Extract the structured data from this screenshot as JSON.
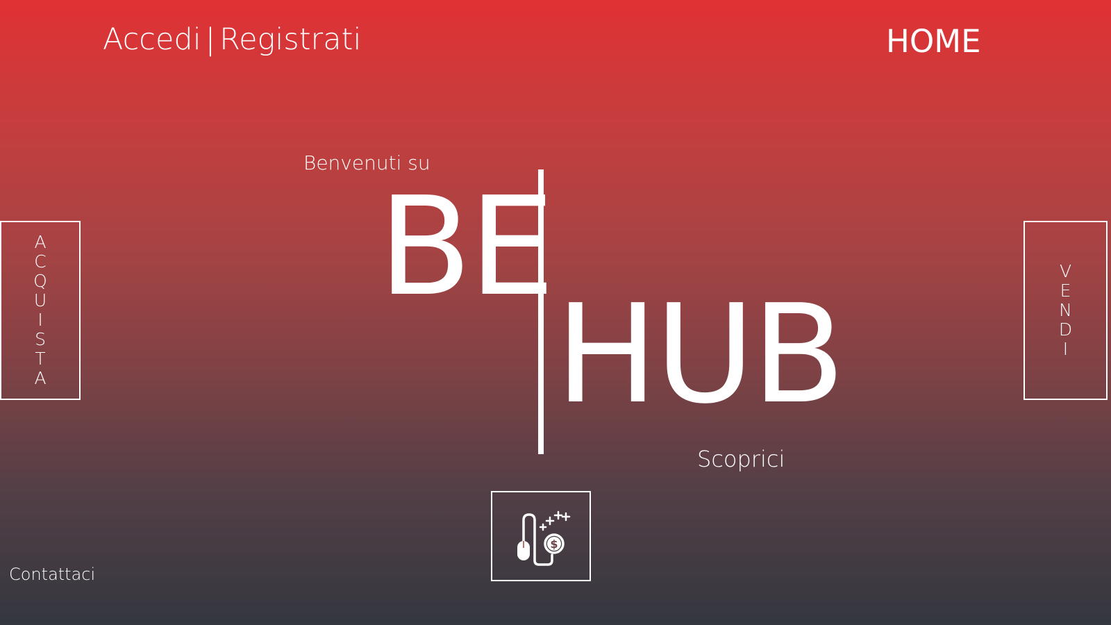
{
  "header": {
    "login_label": "Accedi",
    "separator": "|",
    "register_label": "Registrati",
    "home_label": "HOME"
  },
  "hero": {
    "welcome_text": "Benvenuti su",
    "logo_left": "BE",
    "logo_right": "HUB",
    "discover_label": "Scoprici"
  },
  "side_buttons": {
    "left_label": [
      "A",
      "C",
      "Q",
      "U",
      "I",
      "S",
      "T",
      "A"
    ],
    "right_label": [
      "V",
      "E",
      "N",
      "D",
      "I"
    ]
  },
  "center_icon": {
    "icon": "mouse-money-icon"
  },
  "footer": {
    "contact_label": "Contattaci"
  },
  "colors": {
    "gradient_top": "#e03134",
    "gradient_bottom": "#34373f",
    "foreground": "#ffffff"
  }
}
